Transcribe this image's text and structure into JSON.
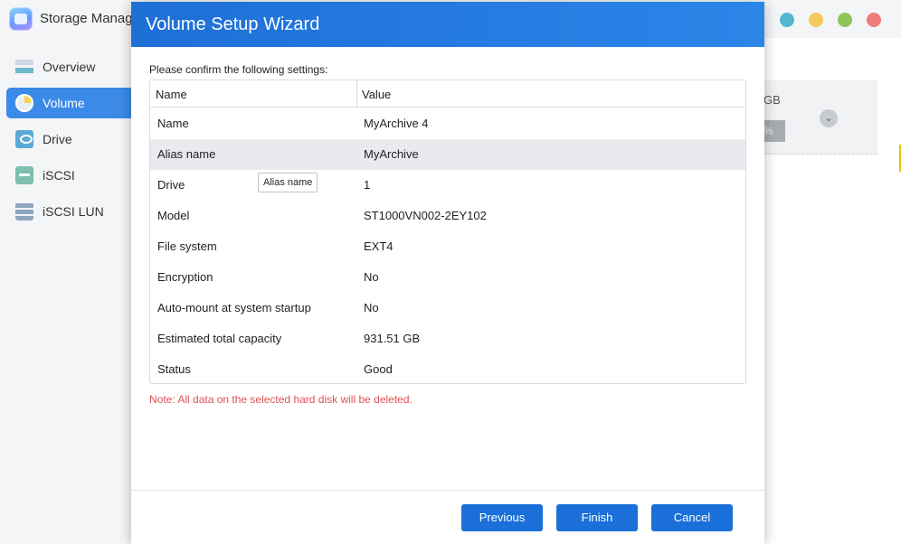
{
  "app": {
    "title": "Storage Manag"
  },
  "sidebar": {
    "items": [
      {
        "label": "Overview",
        "icon": "overview-icon"
      },
      {
        "label": "Volume",
        "icon": "volume-icon",
        "active": true
      },
      {
        "label": "Drive",
        "icon": "drive-icon"
      },
      {
        "label": "iSCSI",
        "icon": "iscsi-icon"
      },
      {
        "label": "iSCSI LUN",
        "icon": "iscsi-lun-icon"
      }
    ]
  },
  "background_card": {
    "capacity_fragment": "GB",
    "bar_fragment": "%"
  },
  "modal": {
    "title": "Volume Setup Wizard",
    "confirm_text": "Please confirm the following settings:",
    "table": {
      "headers": {
        "name": "Name",
        "value": "Value"
      },
      "rows": [
        {
          "name": "Name",
          "value": "MyArchive 4"
        },
        {
          "name": "Alias name",
          "value": "MyArchive"
        },
        {
          "name": "Drive",
          "value": "1"
        },
        {
          "name": "Model",
          "value": "ST1000VN002-2EY102"
        },
        {
          "name": "File system",
          "value": "EXT4"
        },
        {
          "name": "Encryption",
          "value": "No"
        },
        {
          "name": "Auto-mount at system startup",
          "value": "No"
        },
        {
          "name": "Estimated total capacity",
          "value": "931.51 GB"
        },
        {
          "name": "Status",
          "value": "Good"
        }
      ]
    },
    "tooltip": "Alias name",
    "note": "Note: All data on the selected hard disk will be deleted.",
    "buttons": {
      "previous": "Previous",
      "finish": "Finish",
      "cancel": "Cancel"
    }
  },
  "colors": {
    "accent": "#1a70d8",
    "header": "#2b86e8",
    "note": "#e05252"
  }
}
